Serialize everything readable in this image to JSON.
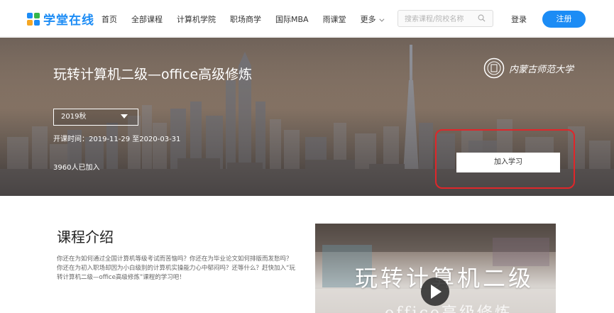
{
  "nav": {
    "logo_text": "学堂在线",
    "links": [
      "首页",
      "全部课程",
      "计算机学院",
      "职场商学",
      "国际MBA",
      "雨课堂"
    ],
    "more_label": "更多",
    "search_placeholder": "搜索课程/院校名称",
    "login_label": "登录",
    "register_label": "注册",
    "logo_colors": [
      "#1c8cf5",
      "#35b64a",
      "#f5a623",
      "#1c8cf5"
    ]
  },
  "banner": {
    "title": "玩转计算机二级—office高级修炼",
    "term_value": "2019秋",
    "dates": "开课时间：2019-11-29 至2020-03-31",
    "enrolled": "3960人已加入",
    "join_label": "加入学习",
    "university_name": "内蒙古师范大学",
    "highlight_color": "#e0262a"
  },
  "intro": {
    "title": "课程介绍",
    "paragraph_lines": [
      "你还在为如何通过全国计算机等级考试而苦恼吗？你还在为毕业论文如何排版而发愁吗？",
      "你还在为初入职场却因为小白级别的计算机实操能力心中郁闷吗？还等什么？赶快加入“玩",
      "转计算机二级—office高级修炼”课程的学习吧！"
    ]
  },
  "video": {
    "title": "玩转计算机二级",
    "subtitle": "office高级修炼"
  },
  "accent_color": "#1c8cf5"
}
